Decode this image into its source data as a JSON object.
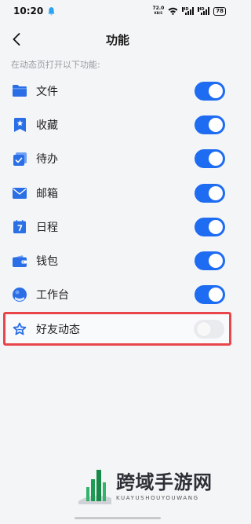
{
  "status_bar": {
    "time": "10:20",
    "net_speed_value": "72.0",
    "net_speed_unit": "KB/S",
    "signal_labels": [
      "HD",
      "HD"
    ],
    "battery": "78"
  },
  "header": {
    "title": "功能"
  },
  "section_hint": "在动态页打开以下功能:",
  "features": [
    {
      "label": "文件",
      "icon": "folder-icon",
      "enabled": true
    },
    {
      "label": "收藏",
      "icon": "bookmark-star-icon",
      "enabled": true
    },
    {
      "label": "待办",
      "icon": "checkbox-icon",
      "enabled": true
    },
    {
      "label": "邮箱",
      "icon": "mail-icon",
      "enabled": true
    },
    {
      "label": "日程",
      "icon": "calendar-icon",
      "enabled": true
    },
    {
      "label": "钱包",
      "icon": "wallet-icon",
      "enabled": true
    },
    {
      "label": "工作台",
      "icon": "workbench-icon",
      "enabled": true
    },
    {
      "label": "好友动态",
      "icon": "star-outline-icon",
      "enabled": false,
      "highlighted": true
    }
  ],
  "watermark": {
    "main": "跨域手游网",
    "sub": "KUAYUSHOUYOUWANG"
  },
  "colors": {
    "accent": "#1e6cf2",
    "toggle_off": "#eaebef",
    "highlight_border": "#e8464a",
    "background": "#f4f5f7"
  }
}
